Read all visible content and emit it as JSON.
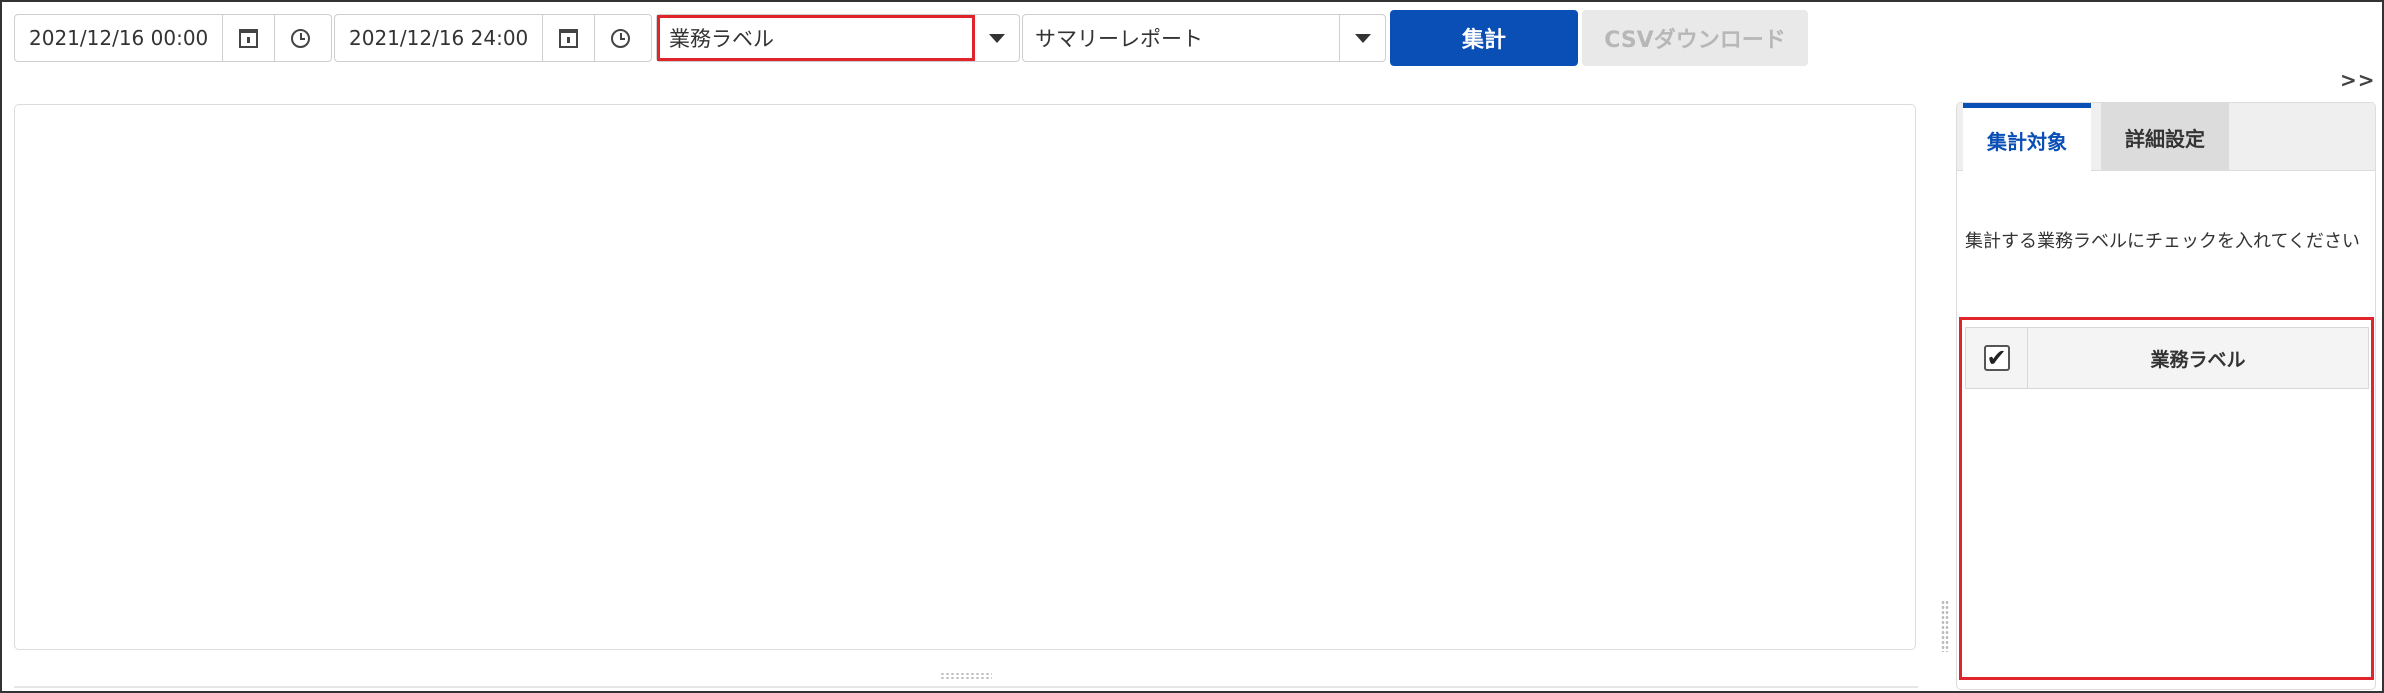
{
  "toolbar": {
    "start_datetime": "2021/12/16 00:00",
    "end_datetime": "2021/12/16 24:00",
    "aggregation_key": "業務ラベル",
    "report_type": "サマリーレポート",
    "aggregate_button": "集計",
    "csv_button": "CSVダウンロード"
  },
  "expand_toggle": ">>",
  "side_panel": {
    "tabs": [
      {
        "label": "集計対象",
        "active": true
      },
      {
        "label": "詳細設定",
        "active": false
      }
    ],
    "hint": "集計する業務ラベルにチェックを入れてください",
    "table": {
      "header_checked": true,
      "column_header": "業務ラベル"
    }
  },
  "colors": {
    "primary": "#0a4fb5",
    "highlight": "#e0242b",
    "disabled_bg": "#e9e9e9",
    "disabled_text": "#b7b7b7"
  }
}
